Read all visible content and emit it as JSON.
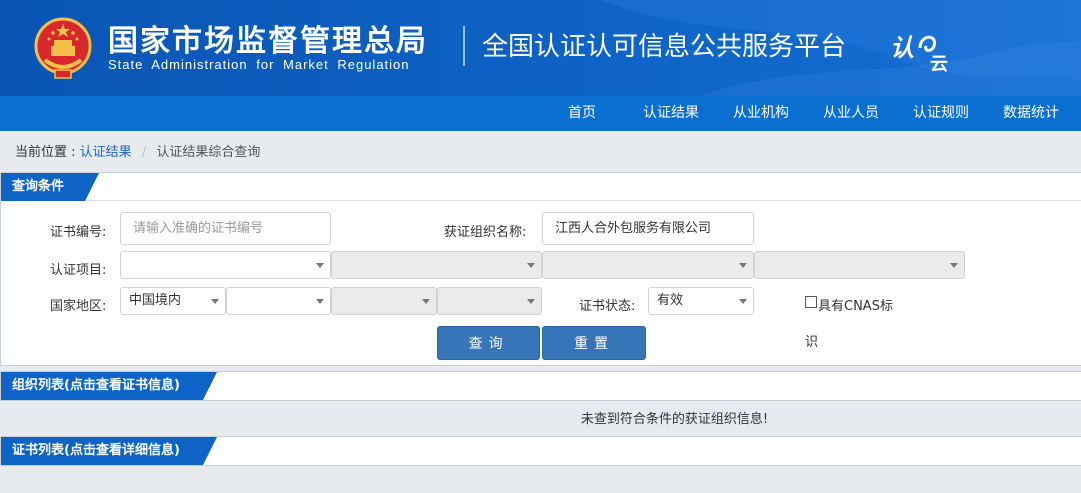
{
  "header": {
    "title_cn": "国家市场监督管理总局",
    "title_en": "State Administration for Market Regulation",
    "platform": "全国认证认可信息公共服务平台",
    "logo_text": "认云"
  },
  "nav": {
    "items": [
      "首页",
      "认证结果",
      "从业机构",
      "从业人员",
      "认证规则",
      "数据统计"
    ]
  },
  "breadcrumb": {
    "prefix": "当前位置 :",
    "link": "认证结果",
    "separator": "/",
    "current": "认证结果综合查询"
  },
  "query": {
    "tab": "查询条件",
    "cert_no_label": "证书编号:",
    "cert_no_placeholder": "请输入准确的证书编号",
    "org_name_label": "获证组织名称:",
    "org_name_value": "江西人合外包服务有限公司",
    "project_label": "认证项目:",
    "region_label": "国家地区:",
    "region_value": "中国境内",
    "status_label": "证书状态:",
    "status_value": "有效",
    "cnas_label_1": "具有CNAS标",
    "cnas_label_2": "识",
    "search_button": "查询",
    "reset_button": "重置"
  },
  "org_list": {
    "tab": "组织列表(点击查看证书信息)",
    "empty_message": "未查到符合条件的获证组织信息!"
  },
  "cert_list": {
    "tab": "证书列表(点击查看详细信息)"
  },
  "colors": {
    "header_blue": "#0d63c6",
    "nav_blue": "#0b6fd0",
    "tab_blue": "#0d63c6",
    "button_blue": "#3775b9",
    "link_blue": "#1a67c4"
  }
}
